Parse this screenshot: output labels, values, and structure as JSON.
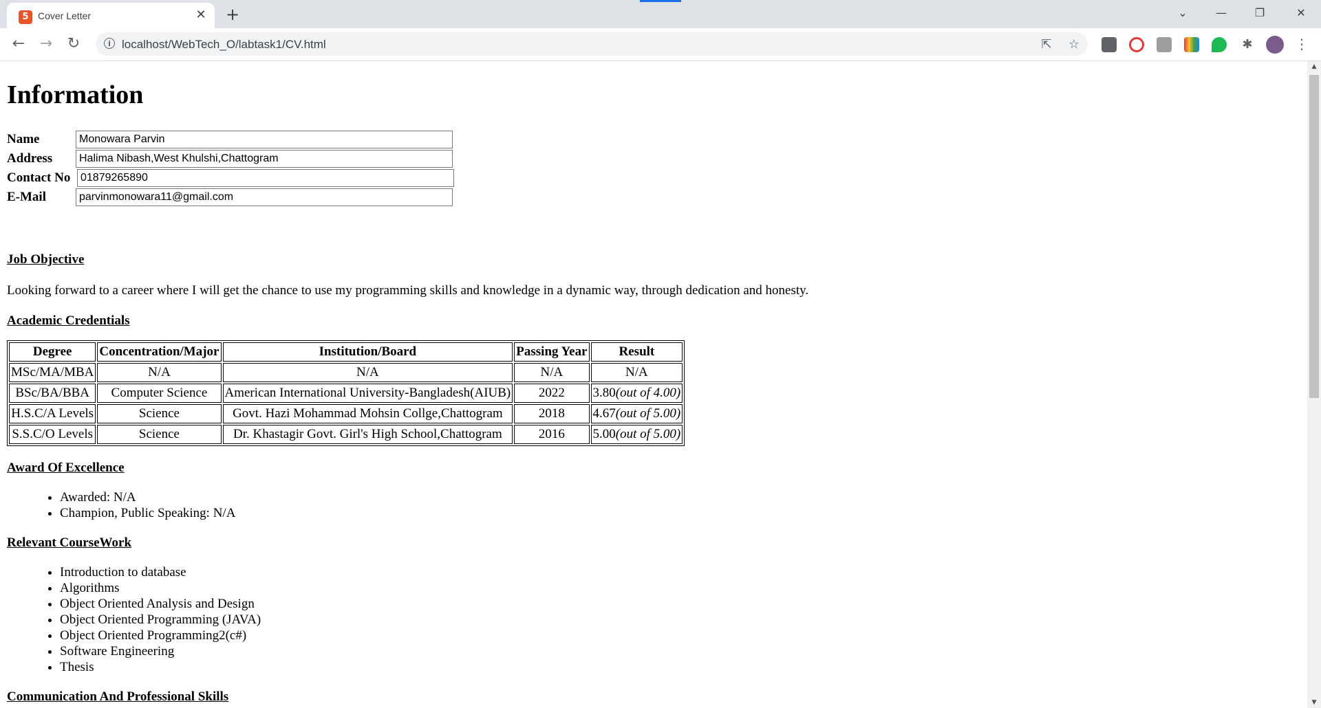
{
  "browser": {
    "tab_title": "Cover Letter",
    "url": "localhost/WebTech_O/labtask1/CV.html"
  },
  "page": {
    "heading": "Information",
    "form": [
      {
        "label": "Name",
        "value": "Monowara Parvin"
      },
      {
        "label": "Address",
        "value": "Halima Nibash,West Khulshi,Chattogram"
      },
      {
        "label": "Contact No",
        "value": "01879265890"
      },
      {
        "label": "E-Mail",
        "value": "parvinmonowara11@gmail.com"
      }
    ],
    "job_objective": {
      "title": "Job Objective",
      "text": "Looking forward to a career where I will get the chance to use my programming skills and knowledge in a dynamic way, through dedication and honesty."
    },
    "academic": {
      "title": "Academic Credentials",
      "headers": [
        "Degree",
        "Concentration/Major",
        "Institution/Board",
        "Passing Year",
        "Result"
      ],
      "rows": [
        {
          "degree": "MSc/MA/MBA",
          "major": "N/A",
          "institution": "N/A",
          "year": "N/A",
          "result": "N/A",
          "scale": ""
        },
        {
          "degree": "BSc/BA/BBA",
          "major": "Computer Science",
          "institution": "American International University-Bangladesh(AIUB)",
          "year": "2022",
          "result": "3.80",
          "scale": "(out of 4.00)"
        },
        {
          "degree": "H.S.C/A Levels",
          "major": "Science",
          "institution": "Govt. Hazi Mohammad Mohsin Collge,Chattogram",
          "year": "2018",
          "result": "4.67",
          "scale": "(out of 5.00)"
        },
        {
          "degree": "S.S.C/O Levels",
          "major": "Science",
          "institution": "Dr. Khastagir Govt. Girl's High School,Chattogram",
          "year": "2016",
          "result": "5.00",
          "scale": "(out of 5.00)"
        }
      ]
    },
    "awards": {
      "title": "Award Of Excellence",
      "items": [
        "Awarded: N/A",
        "Champion, Public Speaking: N/A"
      ]
    },
    "coursework": {
      "title": "Relevant CourseWork",
      "items": [
        "Introduction to database",
        "Algorithms",
        "Object Oriented Analysis and Design",
        "Object Oriented Programming (JAVA)",
        "Object Oriented Programming2(c#)",
        "Software Engineering",
        "Thesis"
      ]
    },
    "skills": {
      "title": "Communication And Professional Skills"
    }
  }
}
